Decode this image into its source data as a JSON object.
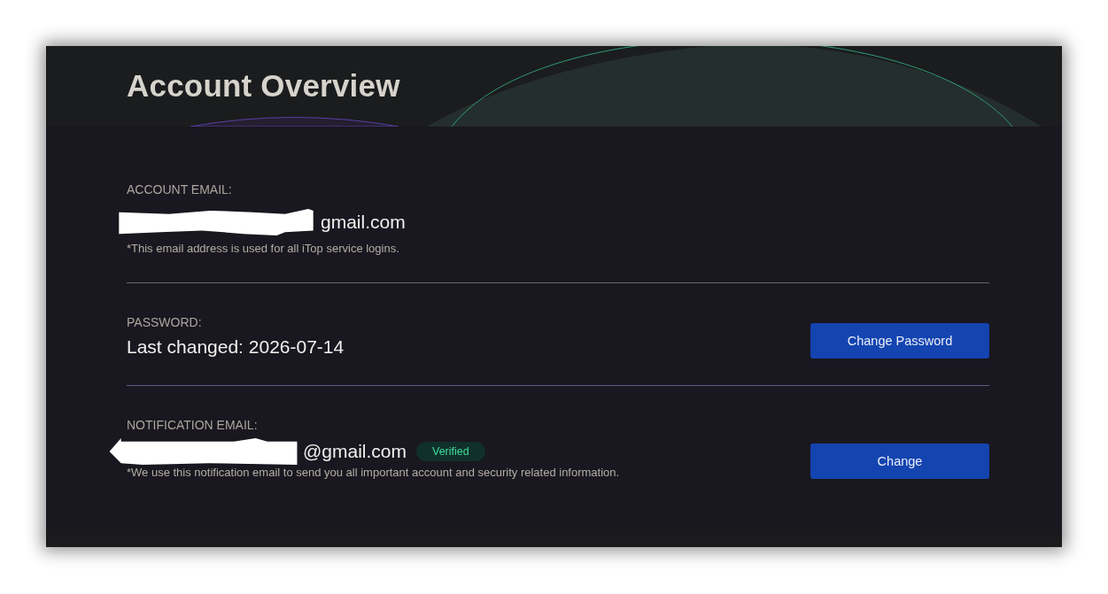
{
  "header": {
    "title": "Account Overview"
  },
  "sections": [
    {
      "kind": "email",
      "label": "ACCOUNT EMAIL:",
      "value": "gmail.com",
      "redacted": true,
      "note": "*This email address is used for all iTop service logins."
    },
    {
      "kind": "password",
      "label": "PASSWORD:",
      "value": "Last changed: 2026-07-14",
      "button": "Change Password"
    },
    {
      "kind": "email",
      "label": "NOTIFICATION EMAIL:",
      "value": "@gmail.com",
      "redacted": true,
      "badge": "Verified",
      "note": "*We use this notification email to send you all important account and security related information.",
      "button": "Change"
    }
  ]
}
